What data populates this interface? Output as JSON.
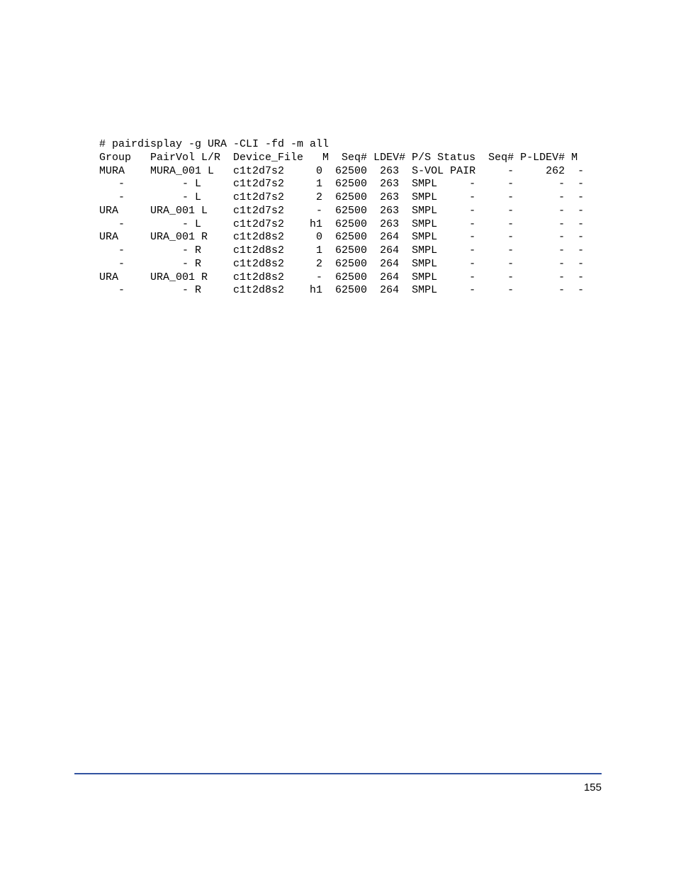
{
  "command": "# pairdisplay -g URA -CLI -fd -m all",
  "header": "Group   PairVol L/R  Device_File   M  Seq# LDEV# P/S Status  Seq# P-LDEV# M",
  "rows": [
    "MURA    MURA_001 L   c1t2d7s2     0  62500  263  S-VOL PAIR     -     262  -",
    "   -         - L     c1t2d7s2     1  62500  263  SMPL     -     -       -  -",
    "   -         - L     c1t2d7s2     2  62500  263  SMPL     -     -       -  -",
    "URA     URA_001 L    c1t2d7s2     -  62500  263  SMPL     -     -       -  -",
    "   -         - L     c1t2d7s2    h1  62500  263  SMPL     -     -       -  -",
    "URA     URA_001 R    c1t2d8s2     0  62500  264  SMPL     -     -       -  -",
    "   -         - R     c1t2d8s2     1  62500  264  SMPL     -     -       -  -",
    "   -         - R     c1t2d8s2     2  62500  264  SMPL     -     -       -  -",
    "URA     URA_001 R    c1t2d8s2     -  62500  264  SMPL     -     -       -  -",
    "   -         - R     c1t2d8s2    h1  62500  264  SMPL     -     -       -  -"
  ],
  "page_number": "155",
  "chart_data": {
    "type": "table",
    "title": "pairdisplay output",
    "columns": [
      "Group",
      "PairVol",
      "L/R",
      "Device_File",
      "M",
      "Seq#",
      "LDEV#",
      "P/S",
      "Status",
      "Seq#",
      "P-LDEV#",
      "M"
    ],
    "rows": [
      [
        "MURA",
        "MURA_001",
        "L",
        "c1t2d7s2",
        "0",
        "62500",
        "263",
        "S-VOL",
        "PAIR",
        "-",
        "262",
        "-"
      ],
      [
        "-",
        "-",
        "L",
        "c1t2d7s2",
        "1",
        "62500",
        "263",
        "SMPL",
        "-",
        "-",
        "-",
        "-"
      ],
      [
        "-",
        "-",
        "L",
        "c1t2d7s2",
        "2",
        "62500",
        "263",
        "SMPL",
        "-",
        "-",
        "-",
        "-"
      ],
      [
        "URA",
        "URA_001",
        "L",
        "c1t2d7s2",
        "-",
        "62500",
        "263",
        "SMPL",
        "-",
        "-",
        "-",
        "-"
      ],
      [
        "-",
        "-",
        "L",
        "c1t2d7s2",
        "h1",
        "62500",
        "263",
        "SMPL",
        "-",
        "-",
        "-",
        "-"
      ],
      [
        "URA",
        "URA_001",
        "R",
        "c1t2d8s2",
        "0",
        "62500",
        "264",
        "SMPL",
        "-",
        "-",
        "-",
        "-"
      ],
      [
        "-",
        "-",
        "R",
        "c1t2d8s2",
        "1",
        "62500",
        "264",
        "SMPL",
        "-",
        "-",
        "-",
        "-"
      ],
      [
        "-",
        "-",
        "R",
        "c1t2d8s2",
        "2",
        "62500",
        "264",
        "SMPL",
        "-",
        "-",
        "-",
        "-"
      ],
      [
        "URA",
        "URA_001",
        "R",
        "c1t2d8s2",
        "-",
        "62500",
        "264",
        "SMPL",
        "-",
        "-",
        "-",
        "-"
      ],
      [
        "-",
        "-",
        "R",
        "c1t2d8s2",
        "h1",
        "62500",
        "264",
        "SMPL",
        "-",
        "-",
        "-",
        "-"
      ]
    ]
  }
}
